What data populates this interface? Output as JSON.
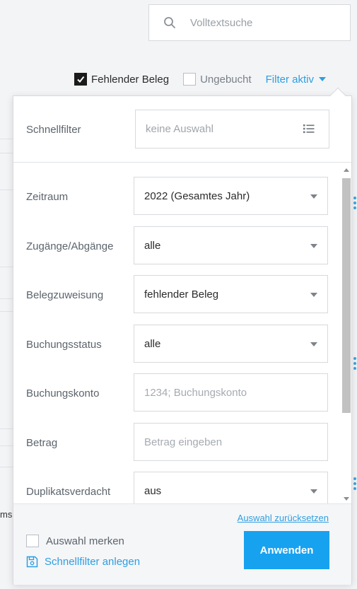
{
  "search": {
    "placeholder": "Volltextsuche"
  },
  "filter_bar": {
    "missing_receipt": {
      "label": "Fehlender Beleg",
      "checked": true
    },
    "unbooked": {
      "label": "Ungebucht",
      "checked": false
    },
    "filter_toggle": "Filter aktiv"
  },
  "background": {
    "clipped_text": "ms"
  },
  "panel": {
    "quick_filter": {
      "label": "Schnellfilter",
      "value": "keine Auswahl"
    },
    "fields": {
      "period": {
        "label": "Zeitraum",
        "value": "2022 (Gesamtes Jahr)"
      },
      "flows": {
        "label": "Zugänge/Abgänge",
        "value": "alle"
      },
      "assignment": {
        "label": "Belegzuweisung",
        "value": "fehlender Beleg"
      },
      "status": {
        "label": "Buchungsstatus",
        "value": "alle"
      },
      "account": {
        "label": "Buchungskonto",
        "placeholder": "1234; Buchungskonto"
      },
      "amount": {
        "label": "Betrag",
        "placeholder": "Betrag eingeben"
      },
      "duplicate": {
        "label": "Duplikatsverdacht",
        "value": "aus"
      }
    },
    "footer": {
      "reset_label": "Auswahl zurücksetzen",
      "remember_label": "Auswahl merken",
      "create_quick_filter_label": "Schnellfilter anlegen",
      "apply_label": "Anwenden"
    }
  },
  "colors": {
    "accent": "#2e9ee0",
    "apply_button": "#17a2f0"
  }
}
